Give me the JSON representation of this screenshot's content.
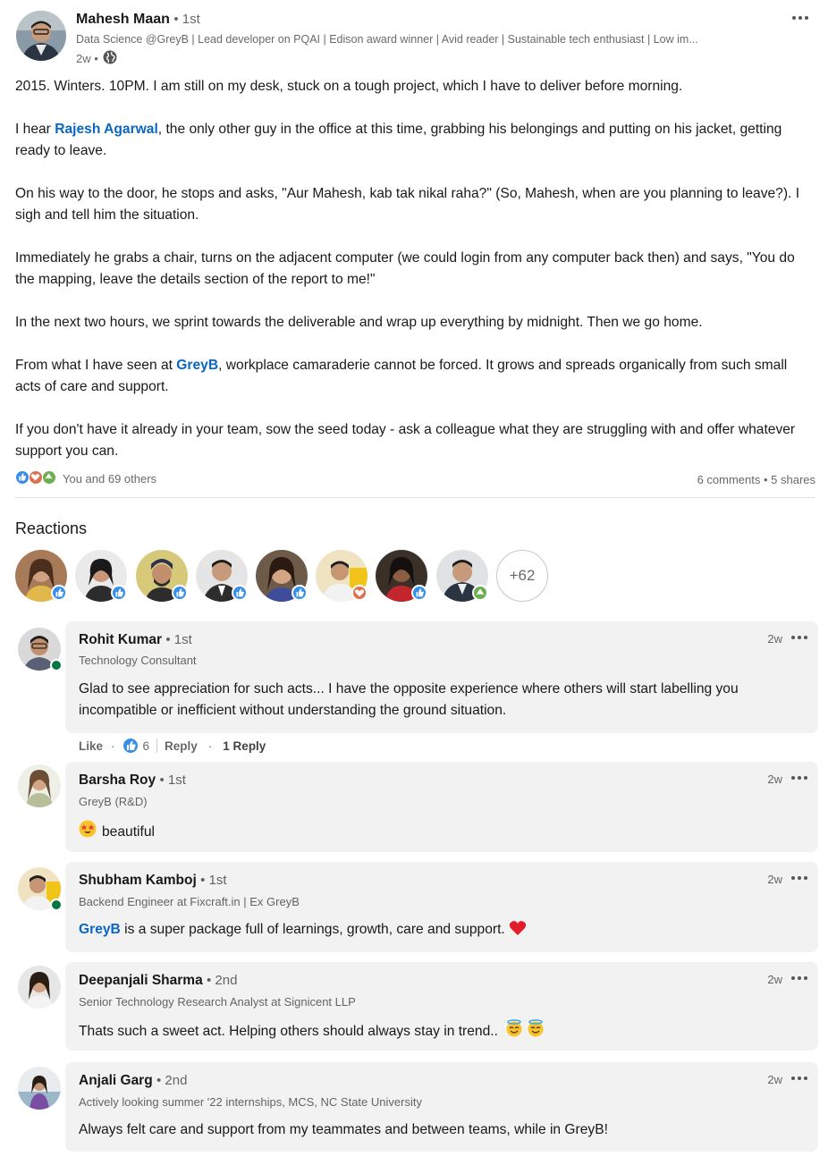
{
  "post": {
    "author": "Mahesh Maan",
    "degree": "• 1st",
    "headline": "Data Science @GreyB | Lead developer on PQAI | Edison award winner | Avid reader | Sustainable tech enthusiast | Low im...",
    "time": "2w •",
    "paragraphs": {
      "p1": "2015. Winters. 10PM. I am still on my desk, stuck on a tough project, which I have to deliver before morning.",
      "p2_before": "I hear ",
      "p2_mention": "Rajesh Agarwal",
      "p2_after": ", the only other guy in the office at this time, grabbing his belongings and putting on his jacket, getting ready to leave.",
      "p3": "On his way to the door, he stops and asks, \"Aur Mahesh, kab tak nikal raha?\" (So, Mahesh, when are you planning to leave?). I sigh and tell him the situation.",
      "p4": "Immediately he grabs a chair, turns on the adjacent computer (we could login from any computer back then) and says, \"You do the mapping, leave the details section of the report to me!\"",
      "p5": "In the next two hours, we sprint towards the deliverable and wrap up everything by midnight. Then we go home.",
      "p6_before": "From what I have seen at ",
      "p6_mention": "GreyB",
      "p6_after": ", workplace camaraderie cannot be forced. It grows and spreads organically from such small acts of care and support.",
      "p7": "If you don't have it already in your team, sow the seed today - ask a colleague what they are struggling with and offer whatever support you can."
    },
    "reactions_summary": "You and 69 others",
    "comments_shares": "6 comments • 5 shares"
  },
  "reactions": {
    "title": "Reactions",
    "more": "+62",
    "items": [
      "like",
      "like",
      "like",
      "like",
      "like",
      "love",
      "like",
      "support"
    ]
  },
  "comments": [
    {
      "name": "Rohit Kumar",
      "degree": "• 1st",
      "headline": "Technology Consultant",
      "time": "2w",
      "text": "Glad to see appreciation for such acts... I have the opposite experience where others will start labelling you incompatible or inefficient without understanding the ground situation.",
      "like_label": "Like",
      "like_count": "6",
      "reply_label": "Reply",
      "replies": "1 Reply"
    },
    {
      "name": "Barsha Roy",
      "degree": "• 1st",
      "headline": "GreyB (R&D)",
      "time": "2w",
      "text": "beautiful"
    },
    {
      "name": "Shubham Kamboj",
      "degree": "• 1st",
      "headline": "Backend Engineer at Fixcraft.in | Ex GreyB",
      "time": "2w",
      "mention": "GreyB",
      "text": " is a super package full of learnings, growth, care and support."
    },
    {
      "name": "Deepanjali Sharma",
      "degree": "• 2nd",
      "headline": "Senior Technology Research Analyst at Signicent LLP",
      "time": "2w",
      "text": "Thats such a sweet act. Helping others should always stay in trend.."
    },
    {
      "name": "Anjali Garg",
      "degree": "• 2nd",
      "headline": "Actively looking summer '22 internships, MCS, NC State University",
      "time": "2w",
      "text": "Always felt care and support from my teammates and between teams, while in GreyB!"
    }
  ],
  "colors": {
    "link": "#0a66c2",
    "like": "#378fe9",
    "love": "#df704d",
    "support": "#6dae4f",
    "online": "#057642"
  }
}
